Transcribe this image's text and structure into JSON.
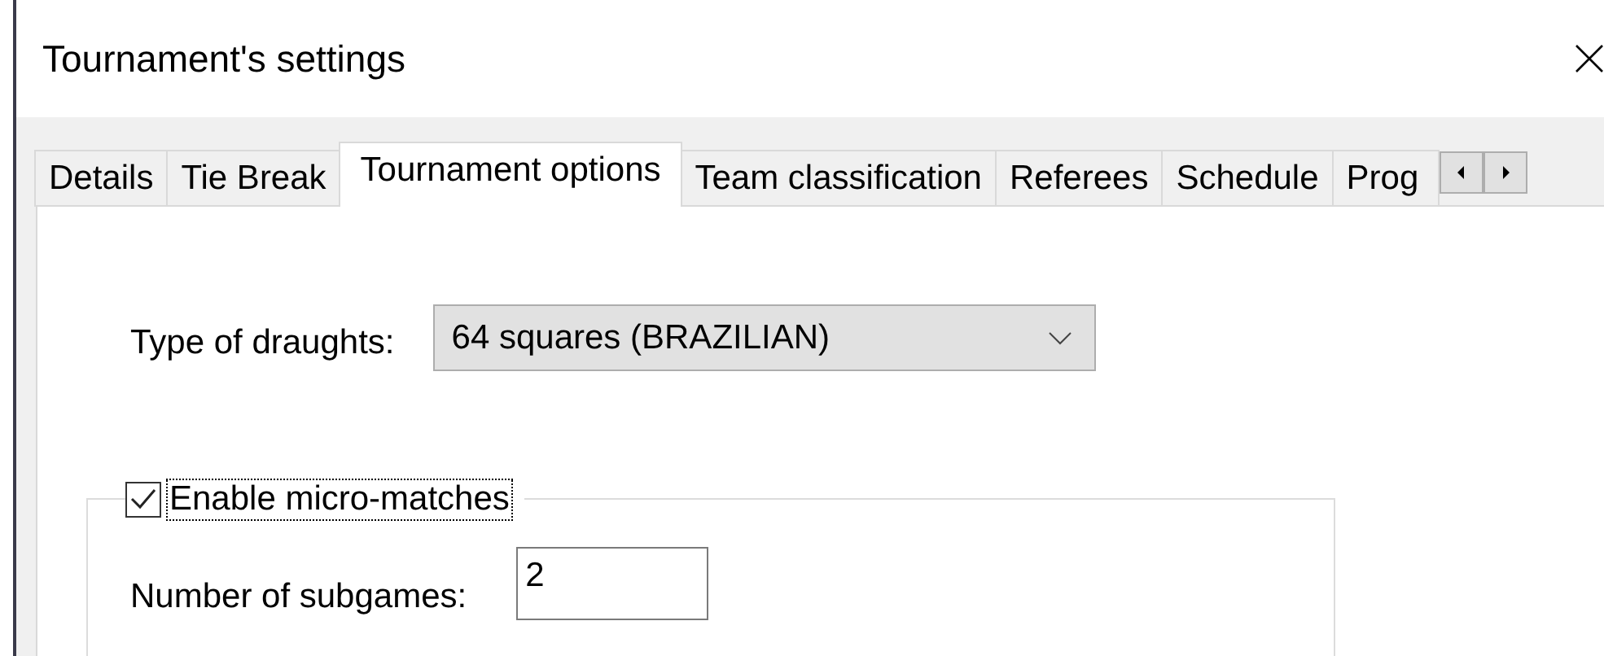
{
  "window": {
    "title": "Tournament's settings"
  },
  "tabs": [
    {
      "label": "Details",
      "selected": false
    },
    {
      "label": "Tie Break",
      "selected": false
    },
    {
      "label": "Tournament options",
      "selected": true
    },
    {
      "label": "Team classification",
      "selected": false
    },
    {
      "label": "Referees",
      "selected": false
    },
    {
      "label": "Schedule",
      "selected": false
    },
    {
      "label": "Prog",
      "selected": false
    }
  ],
  "draughts_type": {
    "label": "Type of draughts:",
    "value": "64 squares (BRAZILIAN)"
  },
  "micro_matches": {
    "label": "Enable micro-matches",
    "checked": true,
    "subgames_label": "Number of subgames:",
    "subgames_value": "2"
  }
}
